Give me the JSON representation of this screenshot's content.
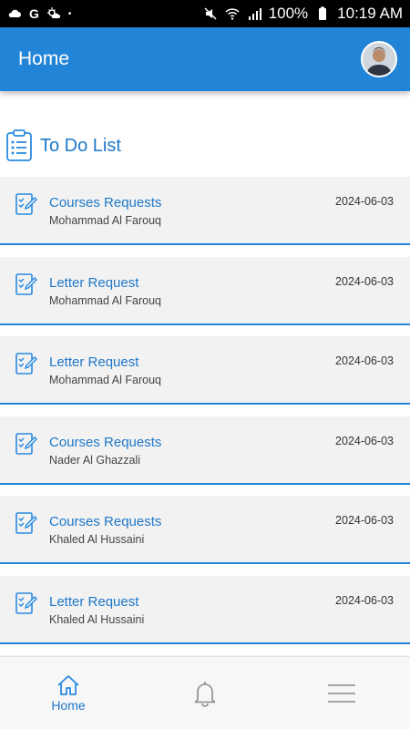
{
  "status_bar": {
    "battery": "100%",
    "time": "10:19 AM"
  },
  "app_bar": {
    "title": "Home"
  },
  "section": {
    "title": "To Do List"
  },
  "todos": [
    {
      "title": "Courses Requests",
      "requester": "Mohammad Al Farouq",
      "date": "2024-06-03"
    },
    {
      "title": "Letter Request",
      "requester": "Mohammad Al Farouq",
      "date": "2024-06-03"
    },
    {
      "title": "Letter Request",
      "requester": "Mohammad Al Farouq",
      "date": "2024-06-03"
    },
    {
      "title": "Courses Requests",
      "requester": "Nader Al Ghazzali",
      "date": "2024-06-03"
    },
    {
      "title": "Courses Requests",
      "requester": "Khaled Al Hussaini",
      "date": "2024-06-03"
    },
    {
      "title": "Letter Request",
      "requester": "Khaled Al Hussaini",
      "date": "2024-06-03"
    }
  ],
  "bottom_nav": {
    "home_label": "Home"
  },
  "colors": {
    "primary": "#2284d6",
    "accent_text": "#1f78c8",
    "item_bg": "#f2f2f2"
  }
}
